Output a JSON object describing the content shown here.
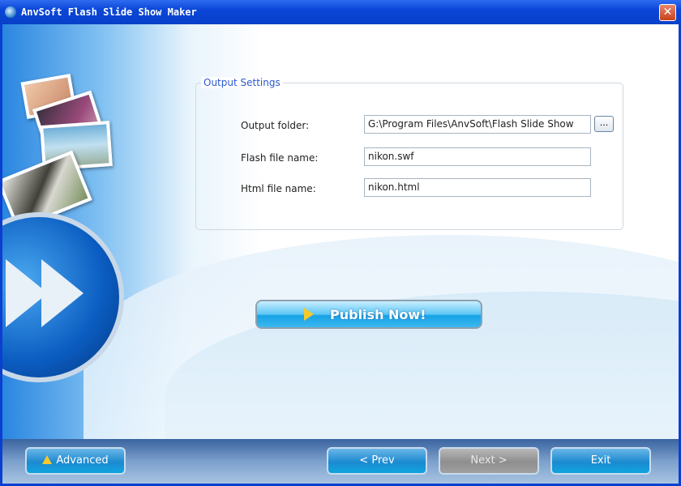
{
  "window": {
    "title": "AnvSoft Flash Slide Show Maker",
    "close_label": "✕"
  },
  "output_settings": {
    "legend": "Output Settings",
    "output_folder_label": "Output folder:",
    "output_folder_value": "G:\\Program Files\\AnvSoft\\Flash Slide Show",
    "browse_label": "...",
    "flash_file_label": "Flash file name:",
    "flash_file_value": "nikon.swf",
    "html_file_label": "Html file name:",
    "html_file_value": "nikon.html"
  },
  "publish_label": "Publish Now!",
  "footer": {
    "advanced": "Advanced",
    "prev": "< Prev",
    "next": "Next >",
    "exit": "Exit"
  }
}
